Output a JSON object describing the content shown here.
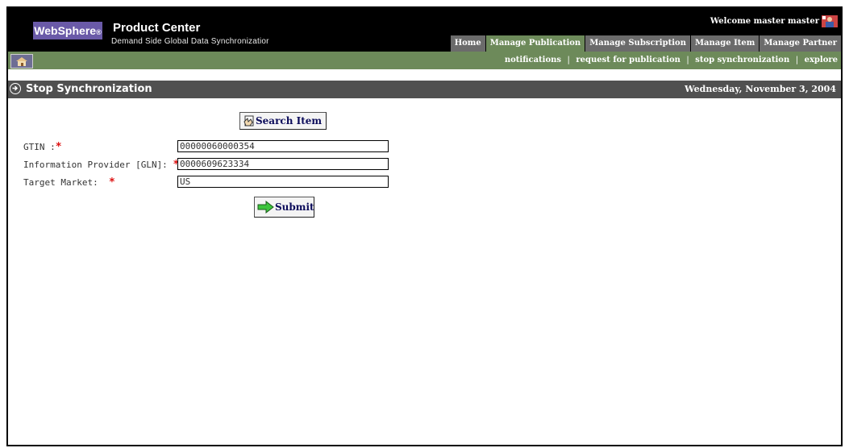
{
  "header": {
    "brand": "WebSphere",
    "brand_mark": "®",
    "product": "Product Center",
    "subtitle": "Demand Side Global Data Synchronizatior",
    "welcome": "Welcome master master",
    "user_icon": "user-profile-icon"
  },
  "nav": {
    "tabs": [
      {
        "label": "Home",
        "active": false
      },
      {
        "label": "Manage Publication",
        "active": true
      },
      {
        "label": "Manage Subscription",
        "active": false
      },
      {
        "label": "Manage Item",
        "active": false
      },
      {
        "label": "Manage Partner",
        "active": false
      }
    ]
  },
  "subnav": {
    "home_icon": "home-icon",
    "links": [
      "notifications",
      "request for publication",
      "stop synchronization",
      "explore"
    ],
    "separator": "|"
  },
  "page": {
    "title": "Stop Synchronization",
    "date": "Wednesday, November 3, 2004"
  },
  "form": {
    "search_button": "Search Item",
    "fields": [
      {
        "label": "GTIN :",
        "value": "00000060000354"
      },
      {
        "label": "Information Provider [GLN]:",
        "value": "0000609623334"
      },
      {
        "label": "Target Market:",
        "value": "US"
      }
    ],
    "required_mark": "*",
    "submit_button": "Submit"
  },
  "colors": {
    "topbar": "#000000",
    "active_tab": "#6d8a5a",
    "inactive_tab": "#6b6b6b",
    "green_bar": "#6d8a5a",
    "title_bar": "#505050",
    "brand_box": "#6a5aa8",
    "required": "#dd1111"
  }
}
